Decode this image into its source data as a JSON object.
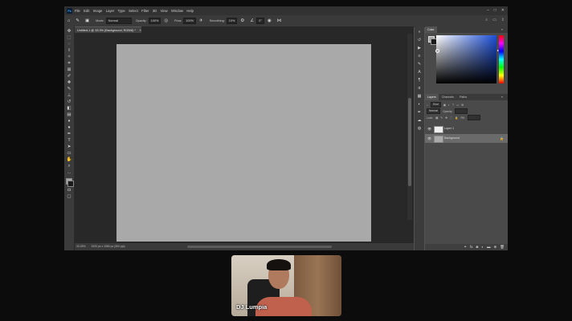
{
  "app": {
    "menu": [
      "File",
      "Edit",
      "Image",
      "Layer",
      "Type",
      "Select",
      "Filter",
      "3D",
      "View",
      "Window",
      "Help"
    ],
    "logo": "Ps"
  },
  "options": {
    "mode_label": "Mode:",
    "mode_value": "Normal",
    "opacity_label": "Opacity:",
    "opacity_value": "100%",
    "flow_label": "Flow:",
    "flow_value": "100%",
    "smoothing_label": "Smoothing:",
    "smoothing_value": "10%",
    "angle_value": "0°"
  },
  "document": {
    "tab_title": "Untitled-1 @ 33.3% (Background, RGB/8) *",
    "zoom": "33.33%",
    "dimensions": "1920 px x 1080 px (300 ppi)"
  },
  "panels": {
    "color_tab": "Color",
    "layers_tab": "Layers",
    "channels_tab": "Channels",
    "paths_tab": "Paths",
    "kind_filter": "Kind",
    "blend_mode": "Normal",
    "opacity_label": "Opacity:",
    "lock_label": "Lock:",
    "fill_label": "Fill:",
    "layers": [
      {
        "name": "Layer 1"
      },
      {
        "name": "Background"
      }
    ]
  },
  "webcam": {
    "name": "DJ Lumpia"
  },
  "colors": {
    "foreground": "#a9a9a9",
    "background": "#1a1a1a",
    "canvas": "#a9a9a9",
    "workspace": "#282828",
    "panel": "#535353"
  }
}
